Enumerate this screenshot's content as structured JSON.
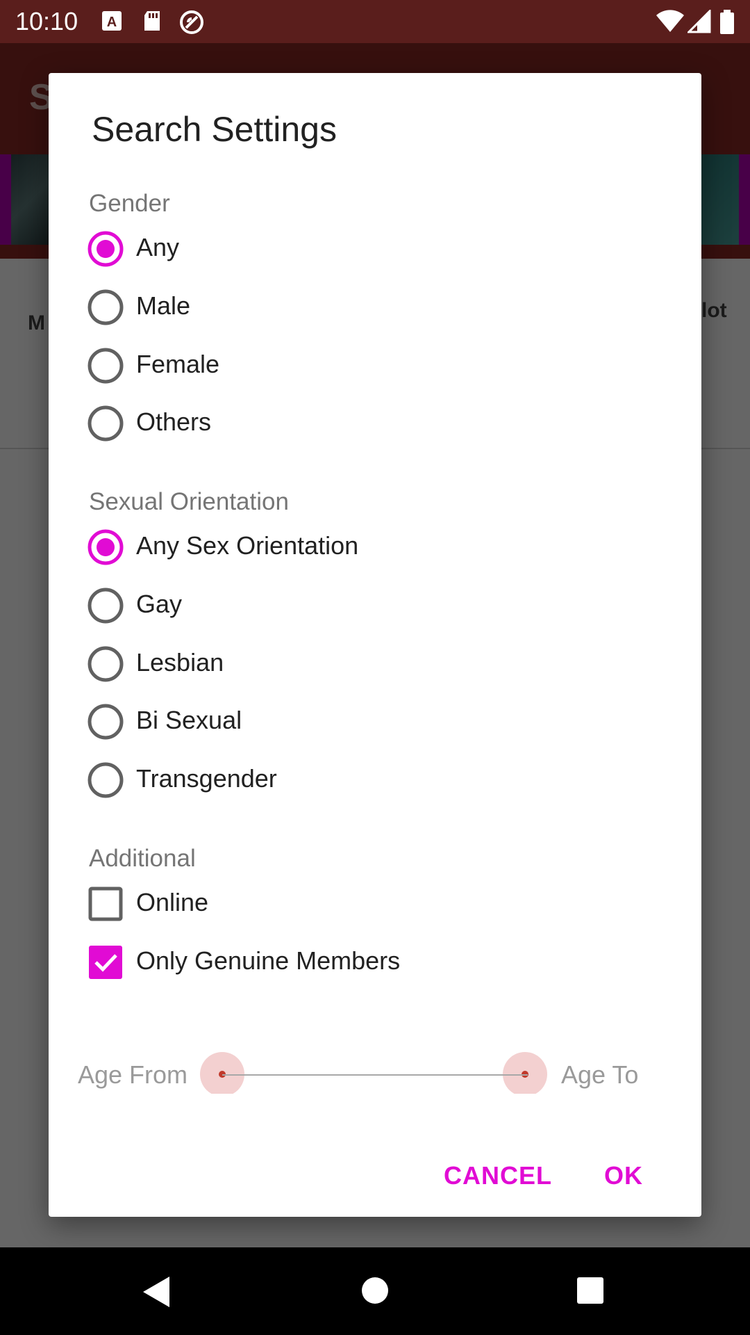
{
  "status_bar": {
    "time": "10:10",
    "left_icons": [
      "a-notification-icon",
      "sd-card-icon",
      "no-disturb-icon"
    ],
    "right_icons": [
      "wifi-icon",
      "cell-signal-icon",
      "battery-icon"
    ]
  },
  "background_app": {
    "toolbar_title_initial": "S",
    "tab_left_partial": "M",
    "tab_right_partial": "lot"
  },
  "dialog": {
    "title": "Search Settings",
    "gender": {
      "label": "Gender",
      "options": [
        {
          "label": "Any",
          "selected": true
        },
        {
          "label": "Male",
          "selected": false
        },
        {
          "label": "Female",
          "selected": false
        },
        {
          "label": "Others",
          "selected": false
        }
      ]
    },
    "orientation": {
      "label": "Sexual Orientation",
      "options": [
        {
          "label": "Any Sex Orientation",
          "selected": true
        },
        {
          "label": "Gay",
          "selected": false
        },
        {
          "label": "Lesbian",
          "selected": false
        },
        {
          "label": "Bi Sexual",
          "selected": false
        },
        {
          "label": "Transgender",
          "selected": false
        }
      ]
    },
    "additional": {
      "label": "Additional",
      "options": [
        {
          "label": "Online",
          "checked": false
        },
        {
          "label": "Only Genuine Members",
          "checked": true
        }
      ]
    },
    "age": {
      "from_label": "Age From",
      "to_label": "Age To"
    },
    "buttons": {
      "cancel": "CANCEL",
      "ok": "OK"
    }
  },
  "colors": {
    "accent": "#e10bd4",
    "status_bar": "#5a1e1c",
    "toolbar": "#8b2a25"
  }
}
